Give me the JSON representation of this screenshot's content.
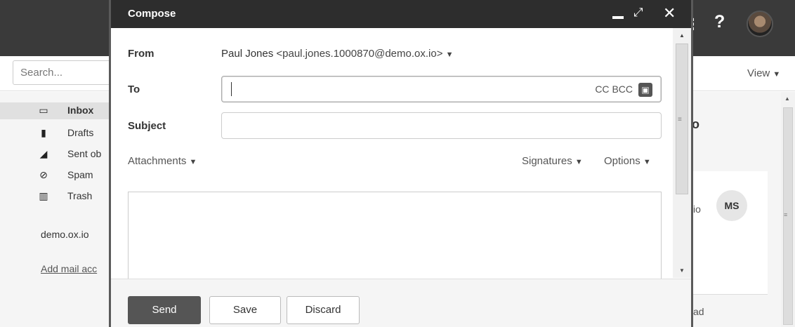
{
  "search": {
    "placeholder": "Search..."
  },
  "toolbar": {
    "view_label": "View"
  },
  "folders": [
    {
      "label": "Inbox",
      "icon": "inbox-icon",
      "glyph": "▭"
    },
    {
      "label": "Drafts",
      "icon": "file-icon",
      "glyph": "▮"
    },
    {
      "label": "Sent ob",
      "icon": "paper-plane-icon",
      "glyph": "◢"
    },
    {
      "label": "Spam",
      "icon": "ban-icon",
      "glyph": "⊘"
    },
    {
      "label": "Trash",
      "icon": "trash-icon",
      "glyph": "▥"
    }
  ],
  "account": {
    "name": "demo.ox.io",
    "add_label": "Add mail acc"
  },
  "reading_pane": {
    "title": "o",
    "text_io": "io",
    "avatar_initials": "MS",
    "text_ad": "ad"
  },
  "compose": {
    "title": "Compose",
    "from_label": "From",
    "from_name": "Paul Jones",
    "from_email": "<paul.jones.1000870@demo.ox.io>",
    "to_label": "To",
    "to_value": "",
    "cc_label": "CC",
    "bcc_label": "BCC",
    "subject_label": "Subject",
    "subject_value": "",
    "attachments_label": "Attachments",
    "signatures_label": "Signatures",
    "options_label": "Options",
    "send_label": "Send",
    "save_label": "Save",
    "discard_label": "Discard"
  },
  "colors": {
    "topbar": "#3a3a3a",
    "compose_header": "#2d2d2d",
    "send_button": "#555555"
  }
}
